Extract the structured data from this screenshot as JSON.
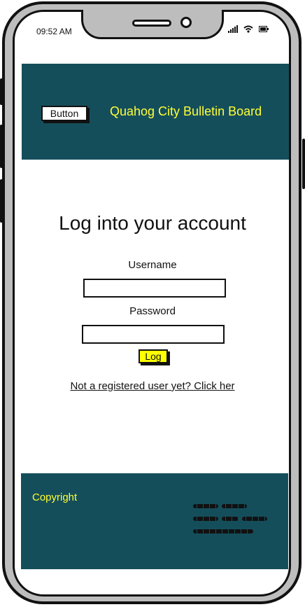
{
  "status_bar": {
    "time": "09:52 AM"
  },
  "header": {
    "button_label": "Button",
    "title": "Quahog City Bulletin Board"
  },
  "login": {
    "heading": "Log into your account",
    "username_label": "Username",
    "password_label": "Password",
    "log_button_label": "Log",
    "register_link": "Not a registered user yet? Click her"
  },
  "footer": {
    "copyright": "Copyright"
  },
  "colors": {
    "header_bg": "#154e5b",
    "title_text": "#ffff33",
    "log_button_bg": "#ffff00"
  }
}
